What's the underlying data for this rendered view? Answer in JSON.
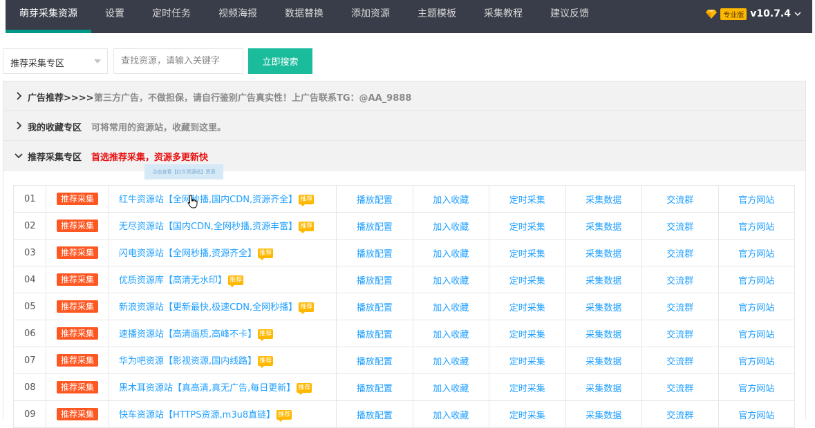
{
  "nav": {
    "items": [
      "萌芽采集资源",
      "设置",
      "定时任务",
      "视频海报",
      "数据替换",
      "添加资源",
      "主题模板",
      "采集教程",
      "建议反馈"
    ],
    "pro_badge": "专业版",
    "version": "v10.7.4"
  },
  "search": {
    "select_value": "推荐采集专区",
    "placeholder": "查找资源，请输入关键字",
    "button_label": "立即搜索"
  },
  "sections": [
    {
      "title": "广告推荐>>>>",
      "desc": "第三方广告，不做担保，请自行鉴别广告真实性！上广告联系TG：@AA_9888",
      "expanded": false
    },
    {
      "title": "我的收藏专区",
      "desc": "可将常用的资源站，收藏到这里。",
      "expanded": false
    },
    {
      "title": "推荐采集专区",
      "desc": "首选推荐采集，资源多更新快",
      "expanded": true
    }
  ],
  "tooltip": "点击查看【红牛资源站】资源",
  "table": {
    "tag_label": "推荐采集",
    "rec_label": "推荐",
    "actions": [
      "播放配置",
      "加入收藏",
      "定时采集",
      "采集数据",
      "交流群",
      "官方网站"
    ],
    "rows": [
      {
        "num": "01",
        "name": "红牛资源站【全网秒播,国内CDN,资源齐全】"
      },
      {
        "num": "02",
        "name": "无尽资源站【国内CDN,全网秒播,资源丰富】"
      },
      {
        "num": "03",
        "name": "闪电资源站【全网秒播,资源齐全】"
      },
      {
        "num": "04",
        "name": "优质资源库【高清无水印】"
      },
      {
        "num": "05",
        "name": "新浪资源站【更新最快,极速CDN,全网秒播】"
      },
      {
        "num": "06",
        "name": "速播资源站【高清画质,高峰不卡】"
      },
      {
        "num": "07",
        "name": "华为吧资源【影视资源,国内线路】"
      },
      {
        "num": "08",
        "name": "黑木耳资源站【真高清,真无广告,每日更新】"
      },
      {
        "num": "09",
        "name": "快车资源站【HTTPS资源,m3u8直链】"
      }
    ]
  },
  "colors": {
    "nav_bg": "#393d49",
    "accent": "#009688",
    "button": "#1abc9c",
    "tag": "#ff5722",
    "link": "#1e9fff",
    "badge": "#ffb800",
    "highlight": "#e81010"
  }
}
